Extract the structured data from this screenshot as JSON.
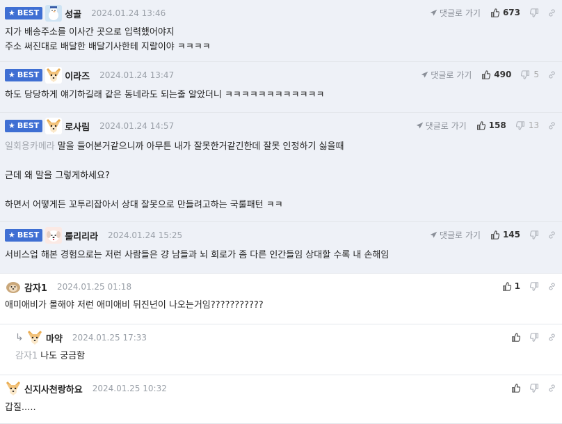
{
  "best_label": "BEST",
  "reply_label": "댓글로 가기",
  "comments": [
    {
      "best": true,
      "nick": "성골",
      "date": "2024.01.24 13:46",
      "likes": "673",
      "dislikes": "",
      "show_reply": true,
      "avatar": "snowman",
      "lines": [
        "지가 배송주소를 이사간 곳으로 입력했어야지",
        "주소 써진대로 배달한 배달기사한테 지랄이야 ㅋㅋㅋㅋ"
      ]
    },
    {
      "best": true,
      "nick": "이라즈",
      "date": "2024.01.24 13:47",
      "likes": "490",
      "dislikes": "5",
      "show_reply": true,
      "avatar": "dog",
      "lines": [
        "하도 당당하게 얘기하길래 같은 동네라도 되는줄 알았더니 ㅋㅋㅋㅋㅋㅋㅋㅋㅋㅋㅋㅋ"
      ]
    },
    {
      "best": true,
      "nick": "로사림",
      "date": "2024.01.24 14:57",
      "likes": "158",
      "dislikes": "13",
      "show_reply": true,
      "avatar": "dog",
      "mention": "일회용카메라",
      "lines": [
        "말을 들어본거같으니까 아무튼 내가 잘못한거같긴한데 잘못 인정하기 싫을때",
        "",
        "근데 왜 말을 그렇게하세요?",
        "",
        "하면서 어떻게든 꼬투리잡아서 상대 잘못으로 만들려고하는 국룰패턴 ㅋㅋ"
      ]
    },
    {
      "best": true,
      "nick": "룰리리라",
      "date": "2024.01.24 15:25",
      "likes": "145",
      "dislikes": "",
      "show_reply": true,
      "avatar": "puppy",
      "lines": [
        "서비스업 해본 경험으로는 저런 사람들은 걍 남들과 뇌 회로가 좀 다른 인간들임 상대할 수록 내 손해임"
      ]
    },
    {
      "best": false,
      "nick": "감자1",
      "date": "2024.01.25 01:18",
      "likes": "1",
      "dislikes": "",
      "show_reply": false,
      "avatar": "potato",
      "lines": [
        "애미애비가 몰해야 저런 애미애비 뒤진년이 나오는거임???????????"
      ]
    },
    {
      "best": false,
      "reply": true,
      "nick": "마약",
      "date": "2024.01.25 17:33",
      "likes": "",
      "dislikes": "",
      "show_reply": false,
      "avatar": "dog",
      "mention": "감자1",
      "lines": [
        "나도 궁금함"
      ]
    },
    {
      "best": false,
      "nick": "신지사천랑하요",
      "date": "2024.01.25 10:32",
      "likes": "",
      "dislikes": "",
      "show_reply": false,
      "avatar": "dog",
      "lines": [
        "갑질....."
      ]
    }
  ]
}
